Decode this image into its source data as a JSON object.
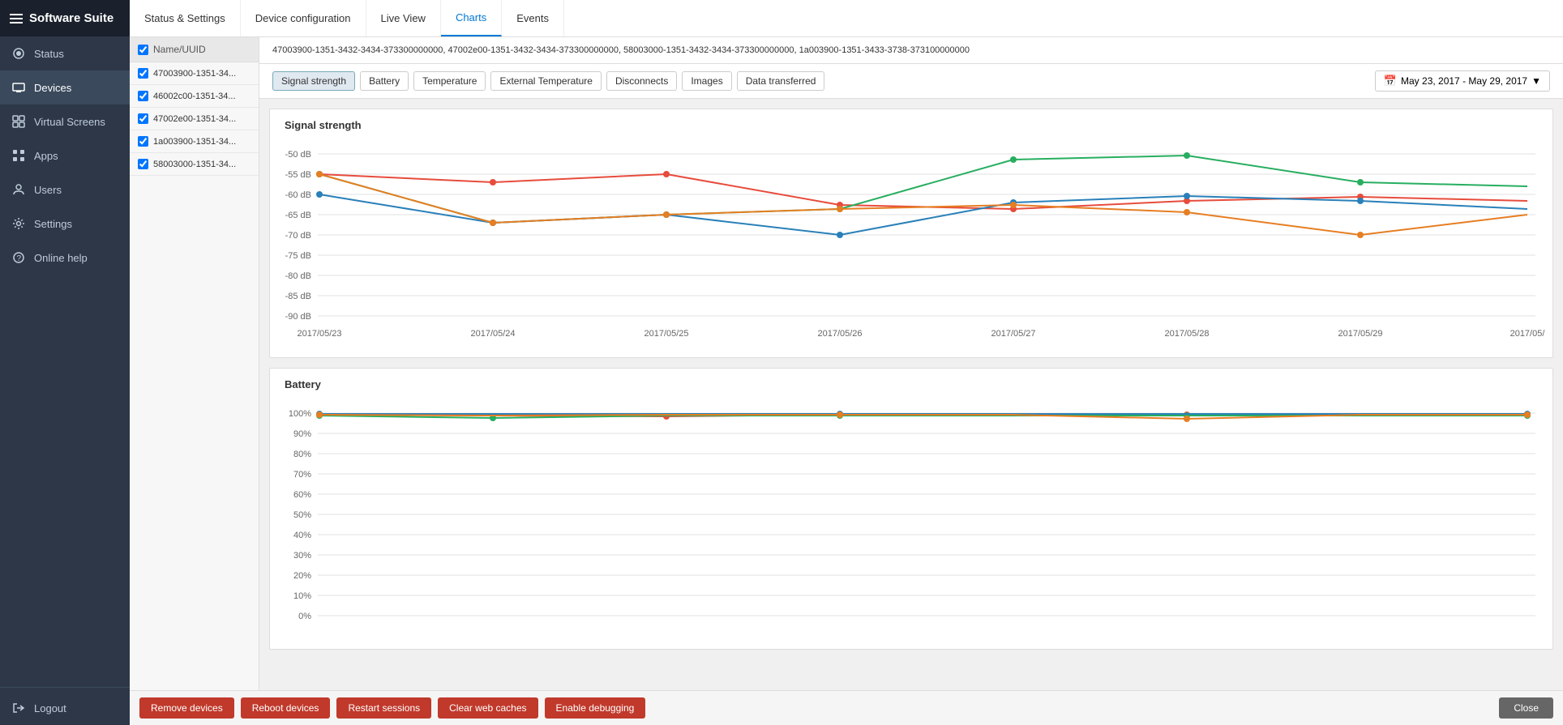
{
  "app": {
    "title": "Software Suite"
  },
  "sidebar": {
    "items": [
      {
        "id": "status",
        "label": "Status",
        "icon": "circle-icon"
      },
      {
        "id": "devices",
        "label": "Devices",
        "icon": "device-icon",
        "active": true
      },
      {
        "id": "virtual-screens",
        "label": "Virtual Screens",
        "icon": "grid-icon"
      },
      {
        "id": "apps",
        "label": "Apps",
        "icon": "apps-icon"
      },
      {
        "id": "users",
        "label": "Users",
        "icon": "user-icon"
      },
      {
        "id": "settings",
        "label": "Settings",
        "icon": "settings-icon"
      },
      {
        "id": "online-help",
        "label": "Online help",
        "icon": "help-icon"
      }
    ],
    "footer": [
      {
        "id": "logout",
        "label": "Logout",
        "icon": "logout-icon"
      }
    ]
  },
  "device_list": {
    "header_label": "Name/UUID",
    "devices": [
      {
        "id": "d1",
        "name": "47003900-1351-34...",
        "checked": true
      },
      {
        "id": "d2",
        "name": "46002c00-1351-34...",
        "checked": true
      },
      {
        "id": "d3",
        "name": "47002e00-1351-34...",
        "checked": true
      },
      {
        "id": "d4",
        "name": "1a003900-1351-34...",
        "checked": true
      },
      {
        "id": "d5",
        "name": "58003000-1351-34...",
        "checked": true
      }
    ]
  },
  "top_nav": {
    "tabs": [
      {
        "id": "status-settings",
        "label": "Status & Settings"
      },
      {
        "id": "device-config",
        "label": "Device configuration"
      },
      {
        "id": "live-view",
        "label": "Live View"
      },
      {
        "id": "charts",
        "label": "Charts",
        "active": true
      },
      {
        "id": "events",
        "label": "Events"
      }
    ]
  },
  "uuid_bar": {
    "text": "47003900-1351-3432-3434-373300000000, 47002e00-1351-3432-3434-373300000000, 58003000-1351-3432-3434-373300000000, 1a003900-1351-3433-3738-373100000000"
  },
  "filter_tabs": {
    "tabs": [
      {
        "id": "signal",
        "label": "Signal strength",
        "active": true
      },
      {
        "id": "battery",
        "label": "Battery"
      },
      {
        "id": "temperature",
        "label": "Temperature"
      },
      {
        "id": "ext-temp",
        "label": "External Temperature"
      },
      {
        "id": "disconnects",
        "label": "Disconnects"
      },
      {
        "id": "images",
        "label": "Images"
      },
      {
        "id": "data-transferred",
        "label": "Data transferred"
      }
    ],
    "date_range": "May 23, 2017 - May 29, 2017"
  },
  "signal_chart": {
    "title": "Signal strength",
    "y_labels": [
      "-50 dB",
      "-55 dB",
      "-60 dB",
      "-65 dB",
      "-70 dB",
      "-75 dB",
      "-80 dB",
      "-85 dB",
      "-90 dB"
    ],
    "x_labels": [
      "2017/05/23",
      "2017/05/24",
      "2017/05/25",
      "2017/05/26",
      "2017/05/27",
      "2017/05/28",
      "2017/05/29",
      "2017/05/"
    ]
  },
  "battery_chart": {
    "title": "Battery",
    "y_labels": [
      "100%",
      "90%",
      "80%",
      "70%",
      "60%",
      "50%",
      "40%",
      "30%",
      "20%",
      "10%",
      "0%"
    ]
  },
  "bottom_toolbar": {
    "buttons": [
      {
        "id": "remove-devices",
        "label": "Remove devices"
      },
      {
        "id": "reboot-devices",
        "label": "Reboot devices"
      },
      {
        "id": "restart-sessions",
        "label": "Restart sessions"
      },
      {
        "id": "clear-web-caches",
        "label": "Clear web caches"
      },
      {
        "id": "enable-debugging",
        "label": "Enable debugging"
      }
    ],
    "close_label": "Close"
  }
}
